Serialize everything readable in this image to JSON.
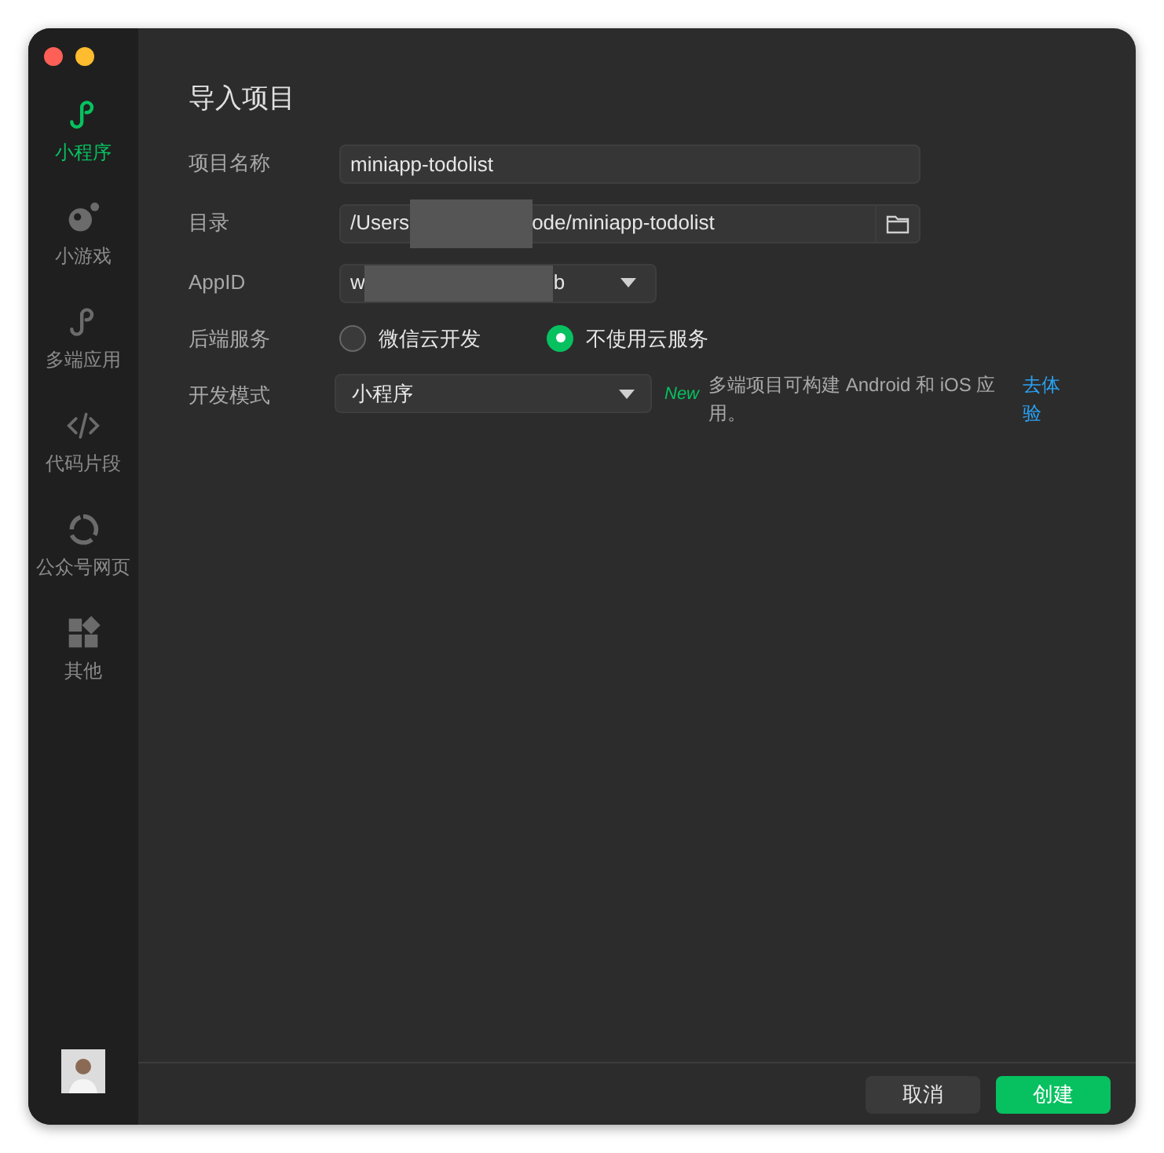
{
  "sidebar": {
    "items": [
      {
        "label": "小程序",
        "selected": true
      },
      {
        "label": "小游戏",
        "selected": false
      },
      {
        "label": "多端应用",
        "selected": false
      },
      {
        "label": "代码片段",
        "selected": false
      },
      {
        "label": "公众号网页",
        "selected": false
      },
      {
        "label": "其他",
        "selected": false
      }
    ]
  },
  "title": "导入项目",
  "form": {
    "rows": [
      {
        "kind": "text",
        "label": "项目名称",
        "value": "miniapp-todolist"
      },
      {
        "kind": "path",
        "label": "目录",
        "value_start": "/Users",
        "value_end": "ode/miniapp-todolist"
      },
      {
        "kind": "select_redacted",
        "label": "AppID",
        "value_start": "w",
        "value_end": "b"
      },
      {
        "kind": "radio",
        "label": "后端服务",
        "options": [
          {
            "label": "微信云开发",
            "selected": false
          },
          {
            "label": "不使用云服务",
            "selected": true
          }
        ]
      },
      {
        "kind": "mode",
        "label": "开发模式",
        "value": "小程序",
        "badge": "New",
        "note": "多端项目可构建 Android 和 iOS 应用。",
        "link": "去体验"
      }
    ]
  },
  "buttons": [
    {
      "label": "取消",
      "kind": "secondary"
    },
    {
      "label": "创建",
      "kind": "primary"
    }
  ]
}
